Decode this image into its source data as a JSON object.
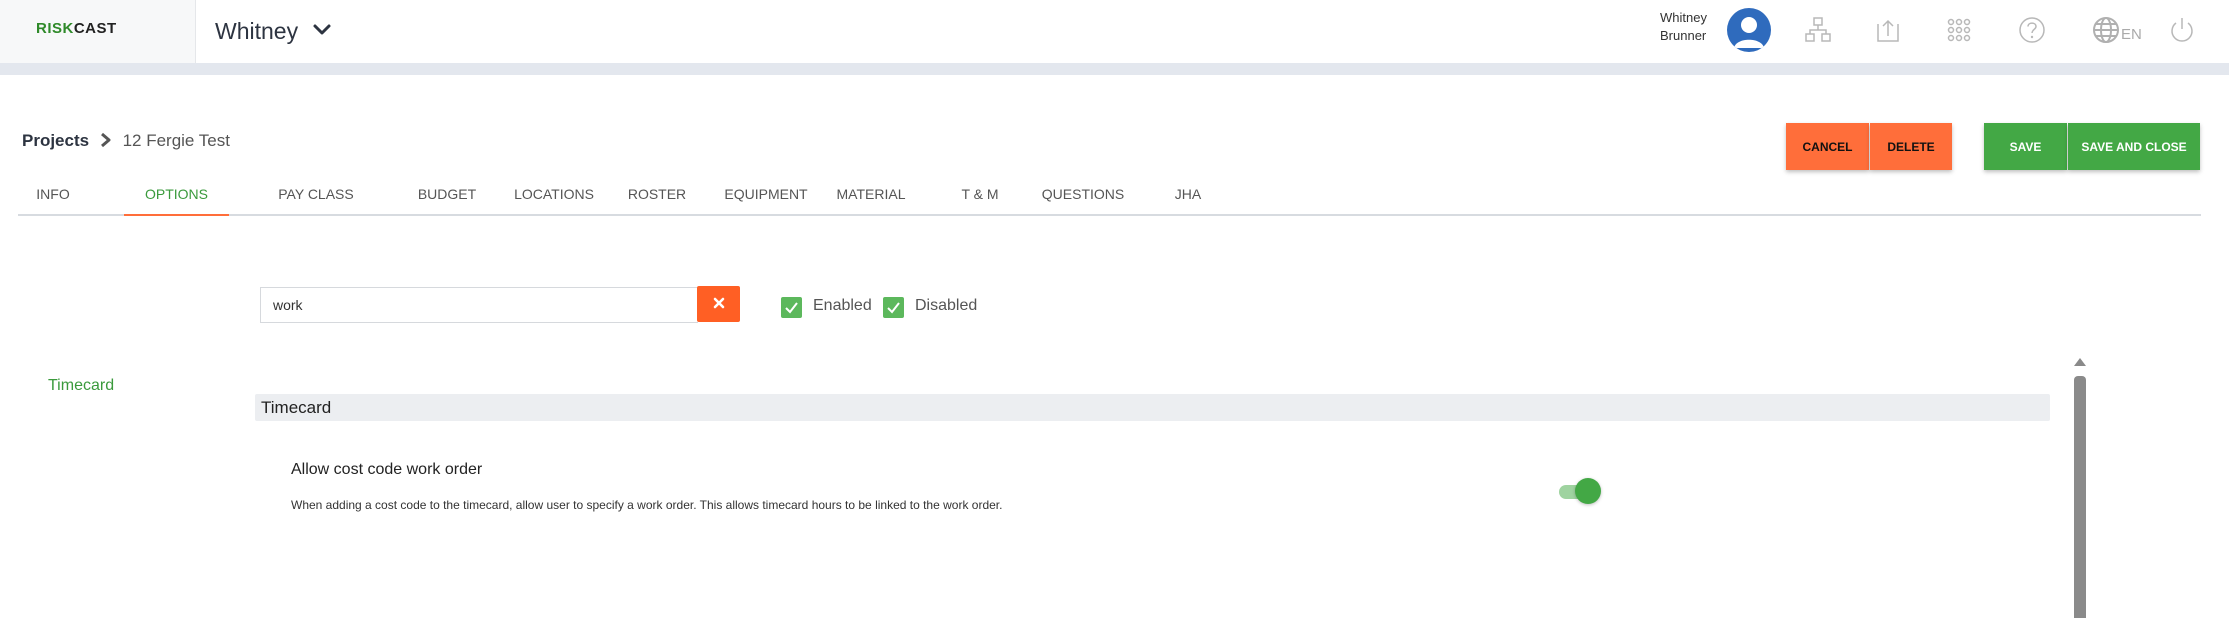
{
  "header": {
    "logo_part1": "RISK",
    "logo_part2": "CAST",
    "company": "Whitney",
    "user_first": "Whitney",
    "user_last": "Brunner",
    "language": "EN"
  },
  "breadcrumb": {
    "root": "Projects",
    "current": "12 Fergie Test"
  },
  "actions": {
    "cancel": "CANCEL",
    "delete": "DELETE",
    "save": "SAVE",
    "save_close": "SAVE AND CLOSE"
  },
  "tabs": [
    {
      "label": "INFO"
    },
    {
      "label": "OPTIONS"
    },
    {
      "label": "PAY CLASS"
    },
    {
      "label": "BUDGET"
    },
    {
      "label": "LOCATIONS"
    },
    {
      "label": "ROSTER"
    },
    {
      "label": "EQUIPMENT"
    },
    {
      "label": "MATERIAL"
    },
    {
      "label": "T & M"
    },
    {
      "label": "QUESTIONS"
    },
    {
      "label": "JHA"
    }
  ],
  "active_tab": "OPTIONS",
  "filter": {
    "search_value": "work",
    "enabled_label": "Enabled",
    "enabled_checked": true,
    "disabled_label": "Disabled",
    "disabled_checked": true
  },
  "sidebar": {
    "link": "Timecard"
  },
  "section": {
    "title": "Timecard",
    "option": {
      "title": "Allow cost code work order",
      "description": "When adding a cost code to the timecard, allow user to specify a work order. This allows timecard hours to be linked to the work order.",
      "enabled": true
    }
  },
  "colors": {
    "accent_green": "#43a845",
    "accent_orange": "#ff6e3a",
    "avatar_blue": "#2f6bbd"
  },
  "icons": [
    "chevron-down-icon",
    "user-avatar-icon",
    "hierarchy-icon",
    "upload-icon",
    "apps-grid-icon",
    "help-icon",
    "globe-icon",
    "power-icon",
    "close-icon",
    "check-icon",
    "scroll-up-icon"
  ]
}
